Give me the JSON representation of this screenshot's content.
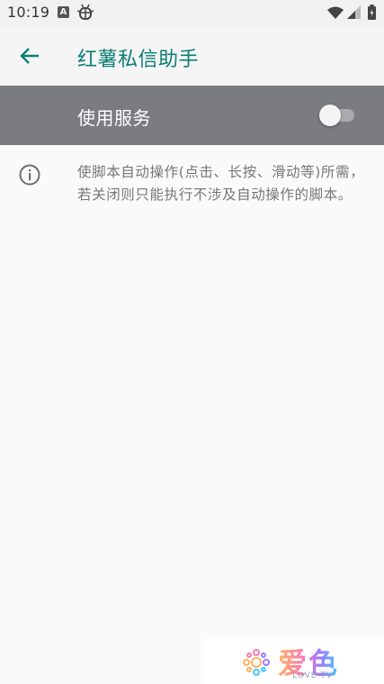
{
  "status_bar": {
    "time": "10:19",
    "icons": [
      "a-notification-icon",
      "bug-notification-icon",
      "wifi-icon",
      "cell-signal-icon",
      "battery-icon"
    ]
  },
  "app_bar": {
    "title": "红薯私信助手",
    "back_icon": "arrow-back-icon",
    "accent_color": "#0a7f73"
  },
  "master_switch": {
    "label": "使用服务",
    "state": "off",
    "background_color": "#7a7c82"
  },
  "info": {
    "icon": "info-icon",
    "text": "使脚本自动操作(点击、长按、滑动等)所需，若关闭则只能执行不涉及自动操作的脚本。"
  },
  "watermark": {
    "brand": "爱色",
    "sub": "LOVE TV"
  }
}
